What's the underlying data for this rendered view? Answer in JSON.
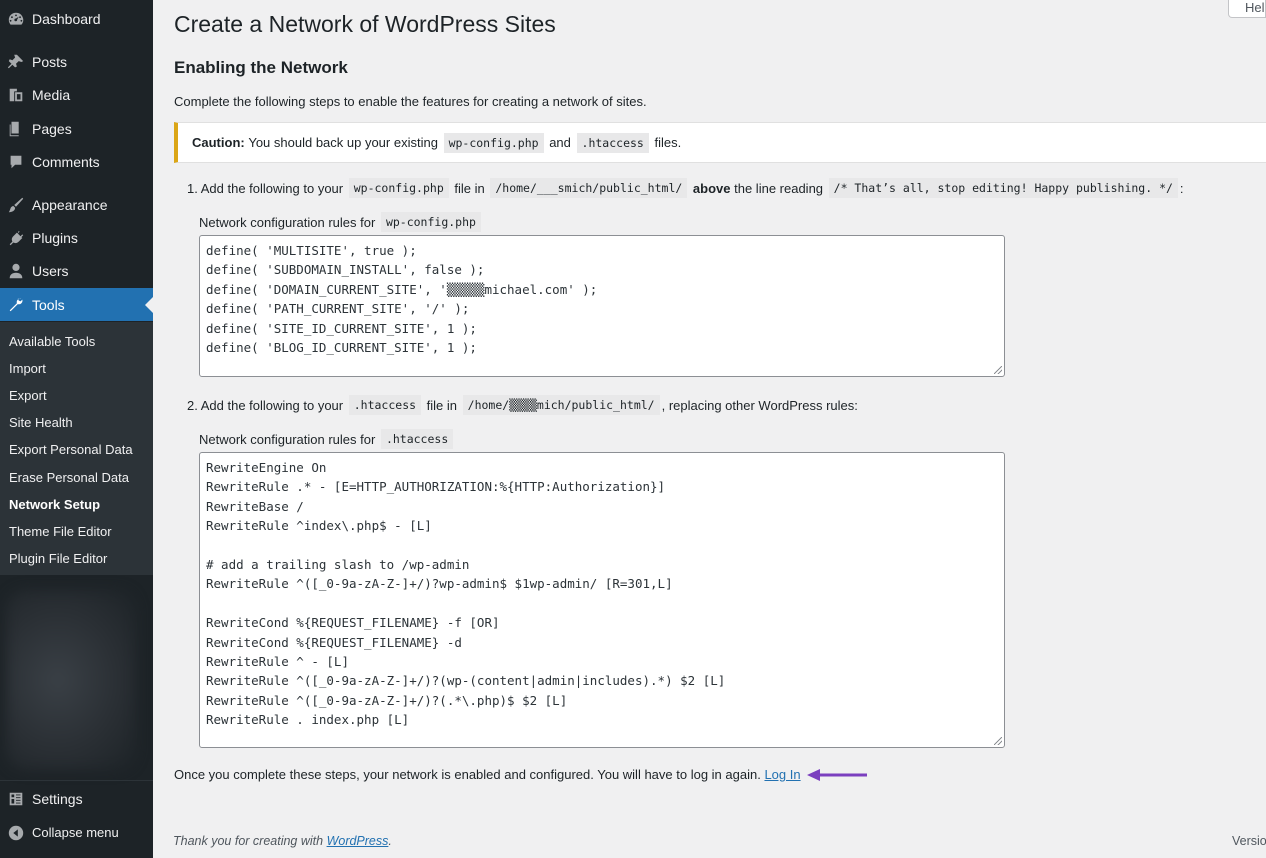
{
  "help_tab": "Help",
  "sidebar": {
    "menu": [
      {
        "label": "Dashboard",
        "icon": "dashboard-icon"
      },
      {
        "label": "Posts",
        "icon": "pushpin-icon"
      },
      {
        "label": "Media",
        "icon": "media-icon"
      },
      {
        "label": "Pages",
        "icon": "pages-icon"
      },
      {
        "label": "Comments",
        "icon": "comment-icon"
      },
      {
        "label": "Appearance",
        "icon": "paintbrush-icon"
      },
      {
        "label": "Plugins",
        "icon": "plug-icon"
      },
      {
        "label": "Users",
        "icon": "user-icon"
      },
      {
        "label": "Tools",
        "icon": "wrench-icon"
      }
    ],
    "submenu": [
      "Available Tools",
      "Import",
      "Export",
      "Site Health",
      "Export Personal Data",
      "Erase Personal Data",
      "Network Setup",
      "Theme File Editor",
      "Plugin File Editor"
    ],
    "current_submenu": "Network Setup",
    "settings": "Settings",
    "collapse": "Collapse menu",
    "active_color": "#2271b1"
  },
  "page": {
    "title": "Create a Network of WordPress Sites",
    "subtitle": "Enabling the Network",
    "intro": "Complete the following steps to enable the features for creating a network of sites.",
    "caution": {
      "bold": "Caution:",
      "text1": "You should back up your existing",
      "code1": "wp-config.php",
      "and": "and",
      "code2": ".htaccess",
      "text2": "files.",
      "border_color": "#dba617"
    },
    "step1": {
      "text1": "1. Add the following to your",
      "code1": "wp-config.php",
      "text2": "file in",
      "path": "/home/___smich/public_html/",
      "bold": "above",
      "text3": "the line reading",
      "code2": "/* That’s all, stop editing! Happy publishing. */",
      "text4": ":",
      "rules_label": "Network configuration rules for",
      "rules_code": "wp-config.php",
      "code": "define( 'MULTISITE', true );\ndefine( 'SUBDOMAIN_INSTALL', false );\ndefine( 'DOMAIN_CURRENT_SITE', '▒▒▒▒▒michael.com' );\ndefine( 'PATH_CURRENT_SITE', '/' );\ndefine( 'SITE_ID_CURRENT_SITE', 1 );\ndefine( 'BLOG_ID_CURRENT_SITE', 1 );"
    },
    "step2": {
      "text1": "2. Add the following to your",
      "code1": ".htaccess",
      "text2": "file in",
      "path": "/home/▒▒▒▒mich/public_html/",
      "text3": ", replacing other WordPress rules:",
      "rules_label": "Network configuration rules for",
      "rules_code": ".htaccess",
      "code": "RewriteEngine On\nRewriteRule .* - [E=HTTP_AUTHORIZATION:%{HTTP:Authorization}]\nRewriteBase /\nRewriteRule ^index\\.php$ - [L]\n\n# add a trailing slash to /wp-admin\nRewriteRule ^([_0-9a-zA-Z-]+/)?wp-admin$ $1wp-admin/ [R=301,L]\n\nRewriteCond %{REQUEST_FILENAME} -f [OR]\nRewriteCond %{REQUEST_FILENAME} -d\nRewriteRule ^ - [L]\nRewriteRule ^([_0-9a-zA-Z-]+/)?(wp-(content|admin|includes).*) $2 [L]\nRewriteRule ^([_0-9a-zA-Z-]+/)?(.*\\.php)$ $2 [L]\nRewriteRule . index.php [L]"
    },
    "finish_text": "Once you complete these steps, your network is enabled and configured. You will have to log in again.",
    "login_link": "Log In",
    "arrow_color": "#7b3fbf"
  },
  "footer": {
    "thanks": "Thank you for creating with",
    "wp_link": "WordPress",
    "period": ".",
    "version": "Version"
  }
}
